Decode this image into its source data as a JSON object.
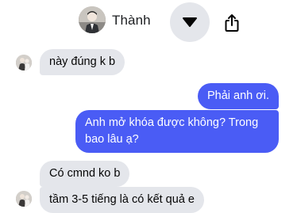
{
  "header": {
    "contact_name": "Thành",
    "avatar_icon": "profile-photo",
    "dropdown_icon": "caret-down-icon",
    "share_icon": "share-icon"
  },
  "colors": {
    "outgoing_bubble": "#4a5cf5",
    "incoming_bubble": "#e4e6eb",
    "header_button": "#e4e6eb"
  },
  "messages": [
    {
      "direction": "incoming",
      "text": "này đúng k b"
    },
    {
      "direction": "outgoing",
      "text": "Phải anh ơi."
    },
    {
      "direction": "outgoing",
      "text": "Anh mở khóa được không? Trong bao lâu ạ?"
    },
    {
      "direction": "incoming",
      "text": "Có cmnd ko b"
    },
    {
      "direction": "incoming",
      "text": "tầm 3-5 tiếng là có kết quả e"
    }
  ]
}
